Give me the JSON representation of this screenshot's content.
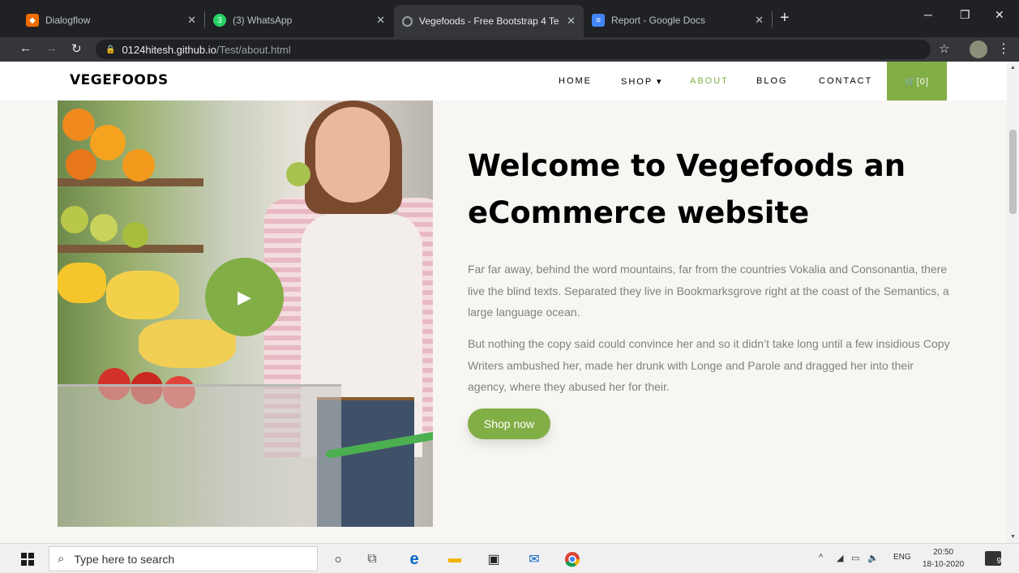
{
  "browser": {
    "tabs": [
      {
        "title": "Dialogflow",
        "favicon": "dialogflow-icon",
        "favicon_color": "#ef6c00",
        "active": false
      },
      {
        "title": "(3) WhatsApp",
        "favicon": "whatsapp-icon",
        "favicon_color": "#25d366",
        "active": false
      },
      {
        "title": "Vegefoods - Free Bootstrap 4 Te",
        "favicon": "loading-icon",
        "favicon_color": "#9aa0a6",
        "active": true
      },
      {
        "title": "Report - Google Docs",
        "favicon": "docs-icon",
        "favicon_color": "#4285f4",
        "active": false
      }
    ],
    "close_glyph": "✕",
    "new_tab": "+",
    "url_host": "0124hitesh.github.io",
    "url_path": "/Test/about.html"
  },
  "site": {
    "brand": "VEGEFOODS",
    "nav": {
      "home": "HOME",
      "shop": "SHOP ▾",
      "about": "ABOUT",
      "blog": "BLOG",
      "contact": "CONTACT",
      "cart": "🛒[0]"
    },
    "accent_color": "#82ae46",
    "heading": "Welcome to Vegefoods an eCommerce website",
    "paragraph_1": "Far far away, behind the word mountains, far from the countries Vokalia and Consonantia, there live the blind texts. Separated they live in Bookmarksgrove right at the coast of the Semantics, a large language ocean.",
    "paragraph_2": "But nothing the copy said could convince her and so it didn’t take long until a few insidious Copy Writers ambushed her, made her drunk with Longe and Parole and dragged her into their agency, where they abused her for their.",
    "shop_button": "Shop now",
    "play_glyph": "▶"
  },
  "taskbar": {
    "search_placeholder": "Type here to search",
    "tray_lang": "ENG",
    "time": "20:50",
    "date": "18-10-2020",
    "notification_count": "9"
  }
}
